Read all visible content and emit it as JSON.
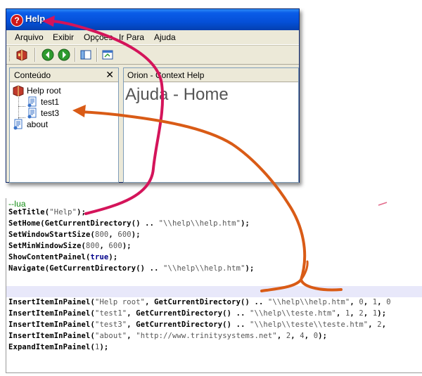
{
  "window": {
    "title": "Help",
    "title_icon": "?"
  },
  "menu": [
    "Arquivo",
    "Exibir",
    "Opções",
    "Ir Para",
    "Ajuda"
  ],
  "toolbar_icons": [
    "book-icon",
    "back-icon",
    "forward-icon",
    "panel-toggle-icon",
    "window-icon"
  ],
  "contents_pane": {
    "title": "Conteúdo",
    "close_label": "✕",
    "tree": [
      {
        "label": "Help root",
        "icon": "book-icon"
      },
      {
        "label": "test1",
        "icon": "page-icon"
      },
      {
        "label": "test3",
        "icon": "page-icon"
      },
      {
        "label": "about",
        "icon": "page-icon"
      }
    ]
  },
  "content_pane": {
    "title": "Orion - Context Help",
    "heading": "Ajuda - Home"
  },
  "code": {
    "comment": "--lua",
    "lines": [
      [
        {
          "t": "SetTitle(",
          "c": ""
        },
        {
          "t": "\"Help\"",
          "c": "str"
        },
        {
          "t": ");",
          "c": ""
        }
      ],
      [
        {
          "t": "SetHome(GetCurrentDirectory() .. ",
          "c": ""
        },
        {
          "t": "\"\\\\help\\\\help.htm\"",
          "c": "str"
        },
        {
          "t": ");",
          "c": ""
        }
      ],
      [
        {
          "t": "SetWindowStartSize(",
          "c": ""
        },
        {
          "t": "800",
          "c": "num"
        },
        {
          "t": ", ",
          "c": ""
        },
        {
          "t": "600",
          "c": "num"
        },
        {
          "t": ");",
          "c": ""
        }
      ],
      [
        {
          "t": "SetMinWindowSize(",
          "c": ""
        },
        {
          "t": "800",
          "c": "num"
        },
        {
          "t": ", ",
          "c": ""
        },
        {
          "t": "600",
          "c": "num"
        },
        {
          "t": ");",
          "c": ""
        }
      ],
      [
        {
          "t": "ShowContentPainel(",
          "c": ""
        },
        {
          "t": "true",
          "c": "kw"
        },
        {
          "t": ");",
          "c": ""
        }
      ],
      [
        {
          "t": "Navigate(GetCurrentDirectory() .. ",
          "c": ""
        },
        {
          "t": "\"\\\\help\\\\help.htm\"",
          "c": "str"
        },
        {
          "t": ");",
          "c": ""
        }
      ]
    ],
    "lines2": [
      [
        {
          "t": "InsertItemInPainel(",
          "c": ""
        },
        {
          "t": "\"Help root\"",
          "c": "str"
        },
        {
          "t": ", GetCurrentDirectory() .. ",
          "c": ""
        },
        {
          "t": "\"\\\\help\\\\help.htm\"",
          "c": "str"
        },
        {
          "t": ", ",
          "c": ""
        },
        {
          "t": "0",
          "c": "num"
        },
        {
          "t": ", ",
          "c": ""
        },
        {
          "t": "1",
          "c": "num"
        },
        {
          "t": ", ",
          "c": ""
        },
        {
          "t": "0",
          "c": "num"
        }
      ],
      [
        {
          "t": "InsertItemInPainel(",
          "c": ""
        },
        {
          "t": "\"test1\"",
          "c": "str"
        },
        {
          "t": ", GetCurrentDirectory() .. ",
          "c": ""
        },
        {
          "t": "\"\\\\help\\\\teste.htm\"",
          "c": "str"
        },
        {
          "t": ", ",
          "c": ""
        },
        {
          "t": "1",
          "c": "num"
        },
        {
          "t": ", ",
          "c": ""
        },
        {
          "t": "2",
          "c": "num"
        },
        {
          "t": ", ",
          "c": ""
        },
        {
          "t": "1",
          "c": "num"
        },
        {
          "t": ");",
          "c": ""
        }
      ],
      [
        {
          "t": "InsertItemInPainel(",
          "c": ""
        },
        {
          "t": "\"test3\"",
          "c": "str"
        },
        {
          "t": ", GetCurrentDirectory() .. ",
          "c": ""
        },
        {
          "t": "\"\\\\help\\\\teste\\\\teste.htm\"",
          "c": "str"
        },
        {
          "t": ", ",
          "c": ""
        },
        {
          "t": "2",
          "c": "num"
        },
        {
          "t": ",",
          "c": ""
        }
      ],
      [
        {
          "t": "InsertItemInPainel(",
          "c": ""
        },
        {
          "t": "\"about\"",
          "c": "str"
        },
        {
          "t": ", ",
          "c": ""
        },
        {
          "t": "\"http://www.trinitysystems.net\"",
          "c": "str"
        },
        {
          "t": ", ",
          "c": ""
        },
        {
          "t": "2",
          "c": "num"
        },
        {
          "t": ", ",
          "c": ""
        },
        {
          "t": "4",
          "c": "num"
        },
        {
          "t": ", ",
          "c": ""
        },
        {
          "t": "0",
          "c": "num"
        },
        {
          "t": ");",
          "c": ""
        }
      ],
      [
        {
          "t": "ExpandItemInPainel(",
          "c": ""
        },
        {
          "t": "1",
          "c": "num"
        },
        {
          "t": ");",
          "c": ""
        }
      ]
    ]
  },
  "colors": {
    "arrow_pink": "#d4145a",
    "arrow_orange": "#d95b16",
    "titlebar": "#0550d8"
  }
}
